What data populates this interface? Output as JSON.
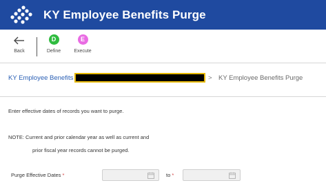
{
  "app": {
    "title": "KY Employee Benefits Purge"
  },
  "toolbar": {
    "back_label": "Back",
    "steps": [
      {
        "letter": "D",
        "label": "Define"
      },
      {
        "letter": "E",
        "label": "Execute"
      }
    ]
  },
  "breadcrumb": {
    "link": "KY Employee Benefits",
    "separator": ">",
    "current": "KY Employee Benefits Purge"
  },
  "content": {
    "instruction": "Enter effective dates of records you want to purge.",
    "note_line1": "NOTE: Current and prior calendar year as well as current and",
    "note_line2": "prior fiscal year records cannot be purged.",
    "field_label": "Purge Effective Dates",
    "required_marker": "*",
    "to_label": "to",
    "from_value": "",
    "to_value": ""
  },
  "colors": {
    "header_bg": "#1f4aa0",
    "define_step": "#2fbb3f",
    "execute_step": "#e96ce3",
    "link": "#2a5fb4",
    "required": "#d13c3c"
  },
  "icons": [
    "app-logo-icon",
    "back-arrow-icon",
    "calendar-icon"
  ]
}
